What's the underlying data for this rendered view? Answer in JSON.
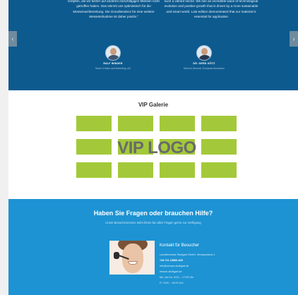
{
  "testimonials": {
    "prev_arrow": "‹",
    "next_arrow": "›",
    "quote_de": "knöpfen, die wir bisher auf anderen einschlägigen Messen nicht getroffen haben. Das stimmt uns optimistisch für die Messenachbereitung. Die Grundtendenz für eine weitere Messeteilnahme ist daher positiv.\"",
    "quote_en": "such a vibrant sector. We see an incredible wave of technological evolution and positive growth that is driven by a more sustainable and smart world. Last edition demonstrated that our material is essential for application",
    "person1": {
      "name": "RALF WINDER",
      "role": "Head of Sales and Marketing, AG"
    },
    "person2": {
      "name": "DR. GERD GÖTZ",
      "role": "Director General, European Aluminium"
    }
  },
  "gallery": {
    "title": "VIP Galerie",
    "logo_text": "VIP LOGO",
    "tile_color": "#a3c93a",
    "tile_count": 16
  },
  "help": {
    "title": "Haben Sie Fragen oder brauchen Hilfe?",
    "subtitle": "Unser Besucherservice steht Ihnen bei allen Fragen gerne zur Verfügung",
    "contact": {
      "heading": "Kontakt für Besucher",
      "address": "Landesmesse Stuttgart GmbH, Messepiazza 1",
      "phone": "+49 711 18560-465",
      "email": "info@messe-stuttgart.de",
      "website": "messe-stuttgart.de",
      "hours_days": "Mo. bis Do. 8:00 – 17:00 Uhr",
      "hours_fri": "Fr. 8:00 – 16:00 Uhr"
    }
  },
  "colors": {
    "testimonial_bg": "#0d5a8f",
    "help_bg": "#1d93d3",
    "gallery_bg": "#ffffff"
  }
}
